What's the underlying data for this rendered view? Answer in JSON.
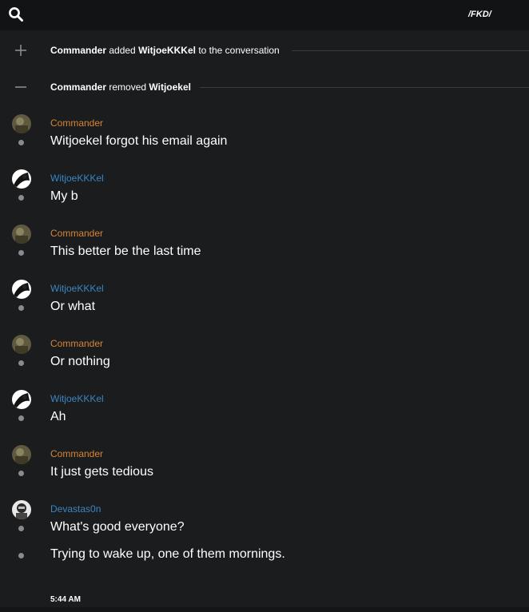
{
  "header": {
    "server_tag": "/FKD/",
    "search_icon": "search-icon"
  },
  "colors": {
    "commander": "#d68435",
    "witjoe": "#3a86c2",
    "devastas": "#3a86c2"
  },
  "system_events": [
    {
      "icon": "plus-icon",
      "actor": "Commander",
      "verb": "added",
      "target": "WitjoeKKKel",
      "suffix": "to the conversation"
    },
    {
      "icon": "minus-icon",
      "actor": "Commander",
      "verb": "removed",
      "target": "Witjoekel",
      "suffix": ""
    }
  ],
  "messages": [
    {
      "author": "Commander",
      "lines": [
        "Witjoekel forgot his email again"
      ]
    },
    {
      "author": "WitjoeKKKel",
      "lines": [
        "My b"
      ]
    },
    {
      "author": "Commander",
      "lines": [
        "This better be the last time"
      ]
    },
    {
      "author": "WitjoeKKKel",
      "lines": [
        "Or what"
      ]
    },
    {
      "author": "Commander",
      "lines": [
        "Or nothing"
      ]
    },
    {
      "author": "WitjoeKKKel",
      "lines": [
        "Ah"
      ]
    },
    {
      "author": "Commander",
      "lines": [
        "It just gets tedious"
      ]
    },
    {
      "author": "Devastas0n",
      "lines": [
        "What's good everyone?",
        "Trying to wake up, one of them mornings."
      ]
    }
  ],
  "timestamp": "5:44 AM"
}
